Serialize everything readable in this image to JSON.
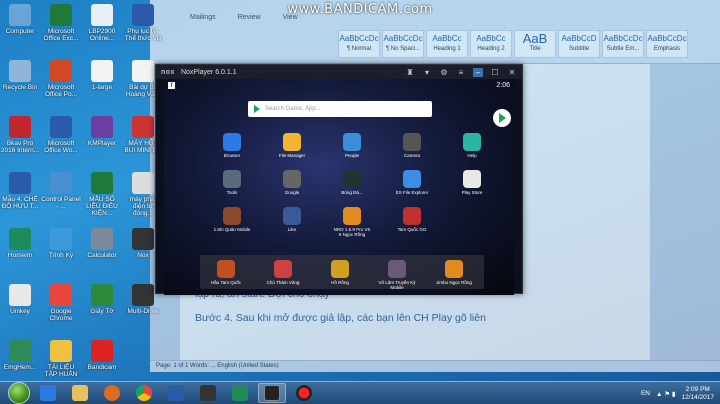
{
  "watermark": "www.BANDICAM.com",
  "word": {
    "tabs": [
      "Mailings",
      "Review",
      "View"
    ],
    "styles": [
      {
        "sample": "AaBbCcDc",
        "name": "¶ Normal"
      },
      {
        "sample": "AaBbCcDc",
        "name": "¶ No Spaci..."
      },
      {
        "sample": "AaBbCc",
        "name": "Heading 1"
      },
      {
        "sample": "AaBbCc",
        "name": "Heading 2"
      },
      {
        "sample": "AaB",
        "name": "Title"
      },
      {
        "sample": "AaBbCcD",
        "name": "Subtitle"
      },
      {
        "sample": "AaBbCcDc",
        "name": "Subtle Em..."
      },
      {
        "sample": "AaBbCcDc",
        "name": "Emphasis"
      }
    ],
    "doc_lines": [
      "lập ra, ấn start. Đợi cho chạy",
      "Bước 4. Sau khi mở được giả lập, các bạn lên CH Play gõ liên"
    ],
    "status": "Page: 1 of 1   Words: ...   English (United States)"
  },
  "desktop_icons": [
    {
      "label": "Computer",
      "color": "#6aa3d8"
    },
    {
      "label": "Microsoft Office Exc...",
      "color": "#1f7a3a"
    },
    {
      "label": "LBP2900 Online...",
      "color": "#e8eef5"
    },
    {
      "label": "Phụ lục IV-Thể thức VB",
      "color": "#2b5aa8"
    },
    {
      "label": "Recycle Bin",
      "color": "#8fb6d8"
    },
    {
      "label": "Microsoft Office Po...",
      "color": "#d24726"
    },
    {
      "label": "1-large",
      "color": "#f3f3f3"
    },
    {
      "label": "Bài dự thi Hoàng Vă...",
      "color": "#f3f3f3"
    },
    {
      "label": "Bkav Pro 2016 Intern...",
      "color": "#c0282d"
    },
    {
      "label": "Microsoft Office Wo...",
      "color": "#2b5aa8"
    },
    {
      "label": "KMPlayer",
      "color": "#6b3fa0"
    },
    {
      "label": "MÁY HÚT BỤI MINI L...",
      "color": "#c33"
    },
    {
      "label": "Mẫu 4. CHẾ ĐỘ HƯU T...",
      "color": "#2b5aa8"
    },
    {
      "label": "Control Panel - ...",
      "color": "#4a8fd1"
    },
    {
      "label": "MẪU SỐ LIỆU ĐIỀU KIỆN...",
      "color": "#1f7a3a"
    },
    {
      "label": "máy phát điện tự đóng...",
      "color": "#ddd"
    },
    {
      "label": "Homeim",
      "color": "#1f8a5a"
    },
    {
      "label": "Trình Ký",
      "color": "#3c9ad8"
    },
    {
      "label": "Calculator",
      "color": "#7a8a9a"
    },
    {
      "label": "Nox",
      "color": "#333"
    },
    {
      "label": "Unikey",
      "color": "#e8e8e8"
    },
    {
      "label": "Google Chrome",
      "color": "#e8453c"
    },
    {
      "label": "Giấy Tờ",
      "color": "#2a8a3a"
    },
    {
      "label": "Multi-Drive",
      "color": "#333"
    },
    {
      "label": "EmgHem...",
      "color": "#2e8b57"
    },
    {
      "label": "TÀI LIỆU TẬP HUẤN",
      "color": "#f0c040"
    },
    {
      "label": "Bandicam",
      "color": "#d22"
    }
  ],
  "nox": {
    "logo": "nox",
    "title": "NoxPlayer 6.0.1.1",
    "time": "2:06",
    "search_placeholder": "Search Game, App...",
    "apps": [
      {
        "label": "Browser",
        "color": "#2c7be5"
      },
      {
        "label": "File Manager",
        "color": "#f2b632"
      },
      {
        "label": "People",
        "color": "#3a8fd8"
      },
      {
        "label": "Camera",
        "color": "#555"
      },
      {
        "label": "Help",
        "color": "#2bb6a3"
      },
      {
        "label": "Tools",
        "color": "#5a6b7c"
      },
      {
        "label": "Google",
        "color": "#666"
      },
      {
        "label": "Bóng Đá...",
        "color": "#233"
      },
      {
        "label": "ES File Explorer",
        "color": "#3c8ee0"
      },
      {
        "label": "Play Store",
        "color": "#e8e8e8"
      },
      {
        "label": "1.8m Quân Mobile",
        "color": "#8a4a2a"
      },
      {
        "label": "Like",
        "color": "#3b5998"
      },
      {
        "label": "NRO 1.5.9 Pro VS 6 Ngọc Rồng",
        "color": "#e08a20"
      },
      {
        "label": "Tam Quốc GO",
        "color": "#c03030"
      }
    ],
    "dock": [
      {
        "label": "Hầu Tam Quốc",
        "color": "#c05020"
      },
      {
        "label": "Chú Thám Vàng",
        "color": "#d04040"
      },
      {
        "label": "Hồ Rồng",
        "color": "#d0a020"
      },
      {
        "label": "Võ Lâm Truyền Kỳ Mobile",
        "color": "#6a5a7a"
      },
      {
        "label": "Jimbo Ngọc Rồng",
        "color": "#e08a20"
      }
    ]
  },
  "taskbar": {
    "items": [
      "ie",
      "explorer",
      "media",
      "chrome",
      "word",
      "nox-taskbar",
      "green",
      "nox2",
      "bandicam"
    ],
    "lang": "EN",
    "time": "2:09 PM",
    "date": "12/14/2017"
  }
}
